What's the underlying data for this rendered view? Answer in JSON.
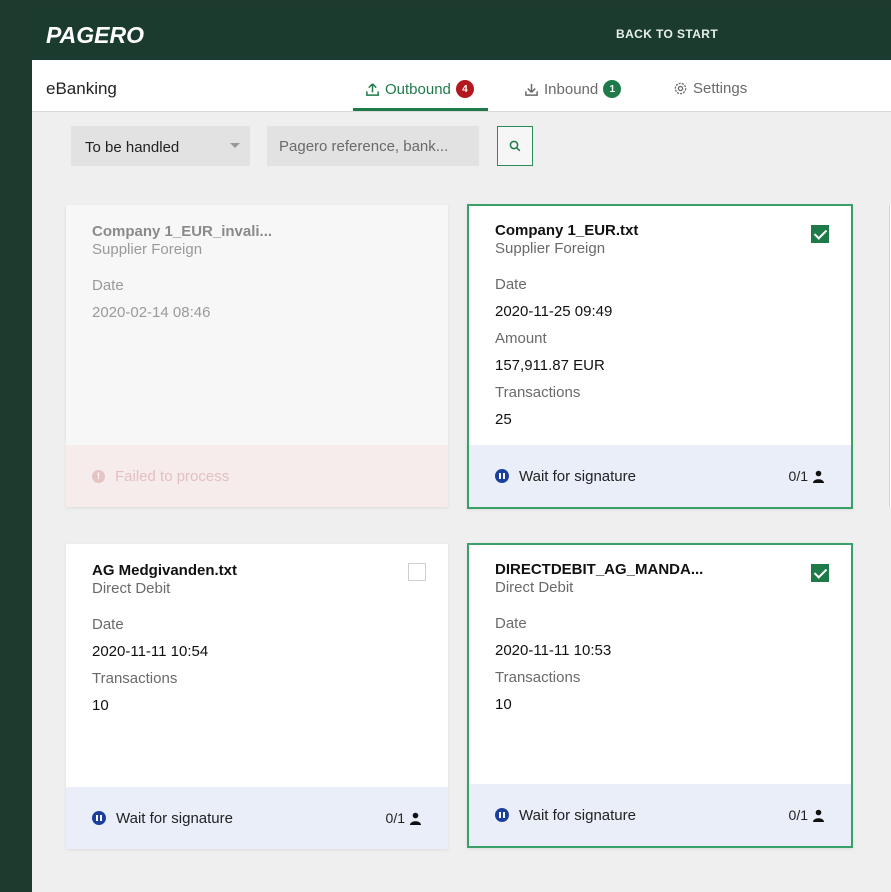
{
  "header": {
    "logo": "PAGERO",
    "back_label": "BACK TO START"
  },
  "nav": {
    "title": "eBanking",
    "tabs": [
      {
        "label": "Outbound",
        "badge": "4",
        "icon": "upload-icon",
        "active": true
      },
      {
        "label": "Inbound",
        "badge": "1",
        "icon": "download-icon",
        "active": false
      },
      {
        "label": "Settings",
        "icon": "gear-icon",
        "active": false
      }
    ]
  },
  "filters": {
    "status_value": "To be handled",
    "search_placeholder": "Pagero reference, bank...",
    "search_icon": "search-icon"
  },
  "cards": [
    {
      "title": "Company 1_EUR_invali...",
      "subtitle": "Supplier Foreign",
      "fields": [
        {
          "label": "Date",
          "value": "2020-02-14 08:46"
        }
      ],
      "footer_status": "Failed to process",
      "state": "failed"
    },
    {
      "title": "Company 1_EUR.txt",
      "subtitle": "Supplier Foreign",
      "fields": [
        {
          "label": "Date",
          "value": "2020-11-25 09:49"
        },
        {
          "label": "Amount",
          "value": "157,911.87 EUR"
        },
        {
          "label": "Transactions",
          "value": "25"
        }
      ],
      "footer_status": "Wait for signature",
      "signatures": "0/1",
      "checked": true
    },
    {
      "title": "AG Medgivanden.txt",
      "subtitle": "Direct Debit",
      "fields": [
        {
          "label": "Date",
          "value": "2020-11-11 10:54"
        },
        {
          "label": "Transactions",
          "value": "10"
        }
      ],
      "footer_status": "Wait for signature",
      "signatures": "0/1",
      "checked": false
    },
    {
      "title": "DIRECTDEBIT_AG_MANDA...",
      "subtitle": "Direct Debit",
      "fields": [
        {
          "label": "Date",
          "value": "2020-11-11 10:53"
        },
        {
          "label": "Transactions",
          "value": "10"
        }
      ],
      "footer_status": "Wait for signature",
      "signatures": "0/1",
      "checked": true
    }
  ],
  "colors": {
    "brand_dark": "#1b3b2f",
    "accent_green": "#1f7a4a",
    "badge_red": "#b4181f",
    "status_blue": "#1b3f9c"
  }
}
